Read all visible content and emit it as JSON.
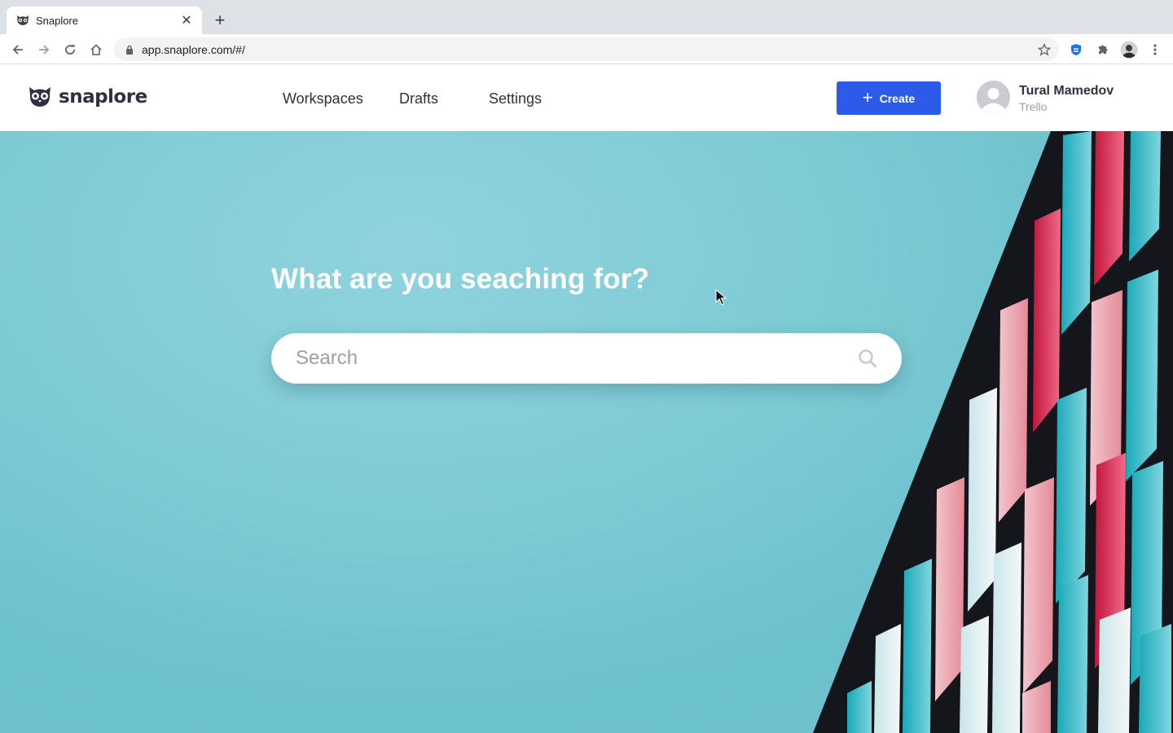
{
  "browser": {
    "tab": {
      "title": "Snaplore",
      "favicon": "owl-icon"
    },
    "url": "app.snaplore.com/#/",
    "icons": [
      "back-icon",
      "forward-icon",
      "reload-icon",
      "home-icon",
      "lock-icon",
      "star-icon",
      "shield-extension-icon",
      "puzzle-extension-icon",
      "profile-avatar-icon",
      "menu-kebab-icon"
    ]
  },
  "header": {
    "logo_text": "snaplore",
    "nav": [
      {
        "label": "Workspaces"
      },
      {
        "label": "Drafts"
      },
      {
        "label": "Settings"
      }
    ],
    "create_label": "Create",
    "user": {
      "name": "Tural Mamedov",
      "org": "Trello"
    }
  },
  "hero": {
    "title": "What are you seaching for?",
    "search_placeholder": "Search"
  },
  "colors": {
    "accent": "#2b5be8",
    "hero_bg": "#7fccd6",
    "text_dark": "#2d3142",
    "text_muted": "#9aa0a6"
  }
}
